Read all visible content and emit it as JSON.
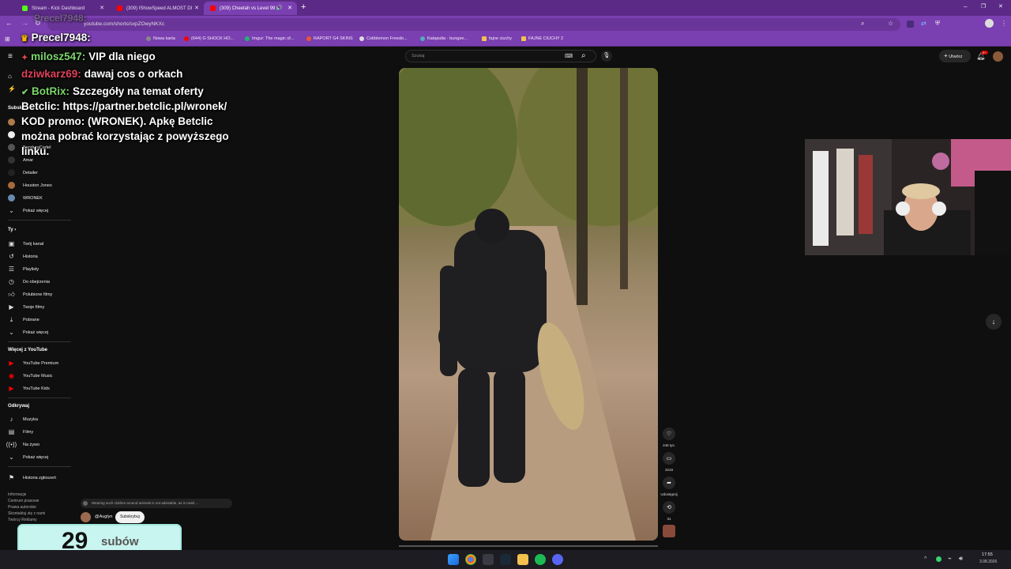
{
  "browser": {
    "tabs": [
      {
        "title": "Stream - Kick Dashboard",
        "color": "#53fc18"
      },
      {
        "title": "(309) IShowSpeed ALMOST DI",
        "color": "#ff0000"
      },
      {
        "title": "(309) Cheetah vs Level 99 I",
        "color": "#ff0000"
      }
    ],
    "url": "youtube.com/shorts/sxpZOwyNKXc",
    "bookmarks": [
      "Nowa karta",
      "(644) G SHOCK HO...",
      "Imgur: The magic of...",
      "RAPORT G4 SKINS",
      "Cobblemon Freedo...",
      "Katapulta - bungee...",
      "fajne ciuchy",
      "FAJNE CIUCHY 2"
    ]
  },
  "youtube": {
    "search_placeholder": "Szukaj",
    "create_label": "Utwórz",
    "notif_count": "9+",
    "sidebar": {
      "subs_header": "Subsk",
      "subscriptions": [
        "BandurаCartel",
        "Amar",
        "Detailer",
        "Houston Jones",
        "WRONEK"
      ],
      "show_more": "Pokaż więcej",
      "you_header": "Ty",
      "you_items": [
        "Twój kanał",
        "Historia",
        "Playlisty",
        "Do obejrzenia",
        "Polubione filmy",
        "Twoje filmy",
        "Pobrane",
        "Pokaż więcej"
      ],
      "more_header": "Więcej z YouTube",
      "more_items": [
        "YouTube Premium",
        "YouTube Music",
        "YouTube Kids"
      ],
      "explore_header": "Odkrywaj",
      "explore_items": [
        "Muzyka",
        "Filmy",
        "Na żywo",
        "Pokaż więcej"
      ],
      "report_history": "Historia zgłoszeń",
      "footer": [
        "Informacje",
        "Centrum prasowe",
        "Prawa autorskie",
        "Skontaktuj się z nami",
        "Twórcy  Reklamy"
      ]
    },
    "short": {
      "comment_preview": "Wearing such clothes around animals is not advisable, as it could ...",
      "channel": "@Auglyn",
      "subscribe_label": "Subskrybuj",
      "likes": "246 tys.",
      "comments": "3219",
      "share": "Udostępnij",
      "remix": "31"
    }
  },
  "chat": [
    {
      "user": "milosz547:",
      "msg": "VIP dla niego",
      "color": "#7bd66b"
    },
    {
      "user": "dziwkarz69:",
      "msg": "dawaj cos o orkach",
      "color": "#e0405a"
    },
    {
      "user": "BotRix:",
      "msg": "Szczegóły na temat oferty",
      "color": "#7bd66b"
    },
    {
      "user": "",
      "msg": "Betclic: https://partner.betclic.pl/wronek/",
      "color": "#ffffff"
    },
    {
      "user": "",
      "msg": "KOD promo: (WRONEK). Apkę Betclic",
      "color": "#ffffff"
    },
    {
      "user": "",
      "msg": "można pobrać korzystając z powyższego",
      "color": "#ffffff"
    },
    {
      "user": "",
      "msg": "linku.",
      "color": "#ffffff"
    }
  ],
  "chat_ghost": {
    "user": "Precel7948:",
    "msg": "Precel7948:"
  },
  "subs_widget": {
    "count": "29",
    "label": "subów"
  },
  "taskbar": {
    "time": "17:55",
    "date": "3.08.2026"
  }
}
